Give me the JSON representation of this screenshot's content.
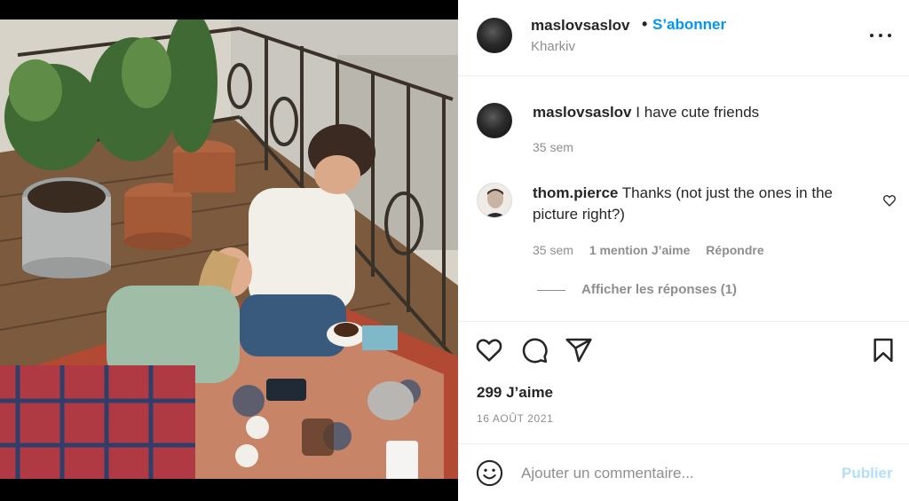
{
  "post": {
    "username": "maslovsaslov",
    "separator": "•",
    "follow_label": "S’abonner",
    "location": "Kharkiv",
    "more_icon": "more-options-icon"
  },
  "caption": {
    "username": "maslovsaslov",
    "text": "I have cute friends",
    "time": "35 sem"
  },
  "comments": [
    {
      "username": "thom.pierce",
      "text_line1": "Thanks (not just the ones in the",
      "text_line2": "picture right?)",
      "time": "35 sem",
      "likes_label": "1 mention J’aime",
      "reply_label": "Répondre",
      "view_replies_label": "Afficher les réponses (1)"
    }
  ],
  "actions": {
    "icons": [
      "heart-icon",
      "comment-icon",
      "share-icon",
      "bookmark-icon"
    ],
    "likes": "299 J’aime",
    "date": "16 AOÛT 2021"
  },
  "add_comment": {
    "placeholder": "Ajouter un commentaire...",
    "publish_label": "Publier",
    "emoji_icon": "emoji-icon"
  },
  "colors": {
    "accent": "#0095f6",
    "publish_disabled": "#b2dffc",
    "secondary_text": "#8e8e8e",
    "primary_text": "#262626",
    "divider": "#efefef"
  }
}
